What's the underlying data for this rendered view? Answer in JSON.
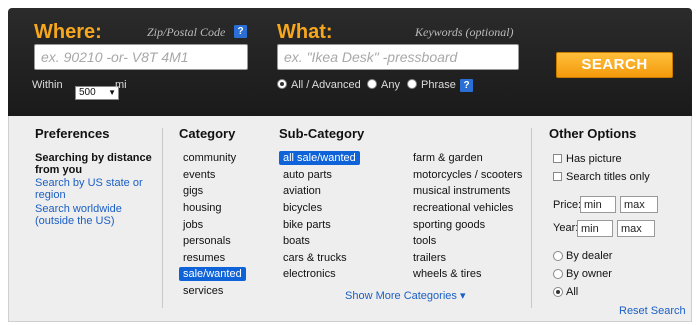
{
  "where": {
    "label": "Where:",
    "hint": "Zip/Postal Code",
    "help": "?",
    "placeholder": "ex. 90210 -or- V8T 4M1"
  },
  "what": {
    "label": "What:",
    "hint": "Keywords (optional)",
    "placeholder": "ex. \"Ikea Desk\" -pressboard"
  },
  "search_button": "SEARCH",
  "within": {
    "label": "Within",
    "value": "500",
    "unit": "mi"
  },
  "match_options": [
    {
      "label": "All / Advanced",
      "selected": true
    },
    {
      "label": "Any",
      "selected": false
    },
    {
      "label": "Phrase",
      "selected": false
    }
  ],
  "match_help": "?",
  "preferences": {
    "heading": "Preferences",
    "status": "Searching by distance from you",
    "links": [
      "Search by US state or region",
      "Search worldwide (outside the US)"
    ]
  },
  "category": {
    "heading": "Category",
    "items": [
      "community",
      "events",
      "gigs",
      "housing",
      "jobs",
      "personals",
      "resumes",
      "sale/wanted",
      "services"
    ],
    "selected": "sale/wanted"
  },
  "subcategory": {
    "heading": "Sub-Category",
    "col1": [
      "all sale/wanted",
      "auto parts",
      "aviation",
      "bicycles",
      "bike parts",
      "boats",
      "cars & trucks",
      "electronics"
    ],
    "col2": [
      "farm & garden",
      "motorcycles / scooters",
      "musical instruments",
      "recreational vehicles",
      "sporting goods",
      "tools",
      "trailers",
      "wheels & tires"
    ],
    "selected": "all sale/wanted",
    "show_more": "Show More Categories ▾"
  },
  "other_options": {
    "heading": "Other Options",
    "checkboxes": [
      "Has picture",
      "Search titles only"
    ],
    "price": {
      "label": "Price:",
      "min": "min",
      "max": "max"
    },
    "year": {
      "label": "Year:",
      "min": "min",
      "max": "max"
    },
    "seller_options": [
      {
        "label": "By dealer",
        "selected": false
      },
      {
        "label": "By owner",
        "selected": false
      },
      {
        "label": "All",
        "selected": true
      }
    ],
    "reset": "Reset Search"
  },
  "colors": {
    "accent": "#f7a71d",
    "link": "#1b5fc4",
    "selected": "#0f63d8",
    "topbar": "#222222"
  }
}
